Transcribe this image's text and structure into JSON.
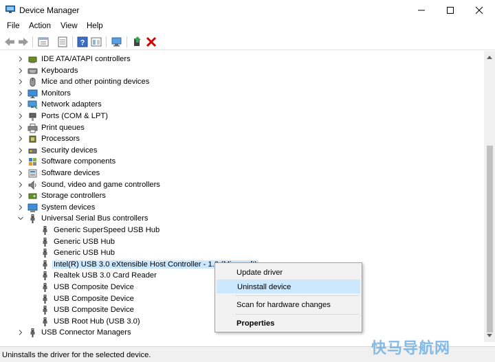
{
  "window": {
    "title": "Device Manager",
    "controls": {
      "minimize": "minimize-icon",
      "maximize": "maximize-icon",
      "close": "close-icon"
    }
  },
  "menu": [
    "File",
    "Action",
    "View",
    "Help"
  ],
  "toolbar": [
    "back-arrow-icon",
    "forward-arrow-icon",
    "properties-pane-icon",
    "device-list-icon",
    "help-icon",
    "view-icon",
    "scan-hardware-icon",
    "update-driver-icon",
    "uninstall-icon"
  ],
  "tree": [
    {
      "label": "IDE ATA/ATAPI controllers",
      "icon": "ide-controller-icon",
      "level": 0,
      "expanded": false
    },
    {
      "label": "Keyboards",
      "icon": "keyboard-icon",
      "level": 0,
      "expanded": false
    },
    {
      "label": "Mice and other pointing devices",
      "icon": "mouse-icon",
      "level": 0,
      "expanded": false
    },
    {
      "label": "Monitors",
      "icon": "monitor-icon",
      "level": 0,
      "expanded": false
    },
    {
      "label": "Network adapters",
      "icon": "network-adapter-icon",
      "level": 0,
      "expanded": false
    },
    {
      "label": "Ports (COM & LPT)",
      "icon": "port-icon",
      "level": 0,
      "expanded": false
    },
    {
      "label": "Print queues",
      "icon": "printer-icon",
      "level": 0,
      "expanded": false
    },
    {
      "label": "Processors",
      "icon": "processor-icon",
      "level": 0,
      "expanded": false
    },
    {
      "label": "Security devices",
      "icon": "security-device-icon",
      "level": 0,
      "expanded": false
    },
    {
      "label": "Software components",
      "icon": "software-component-icon",
      "level": 0,
      "expanded": false
    },
    {
      "label": "Software devices",
      "icon": "software-device-icon",
      "level": 0,
      "expanded": false
    },
    {
      "label": "Sound, video and game controllers",
      "icon": "speaker-icon",
      "level": 0,
      "expanded": false
    },
    {
      "label": "Storage controllers",
      "icon": "storage-controller-icon",
      "level": 0,
      "expanded": false
    },
    {
      "label": "System devices",
      "icon": "system-device-icon",
      "level": 0,
      "expanded": false
    },
    {
      "label": "Universal Serial Bus controllers",
      "icon": "usb-icon",
      "level": 0,
      "expanded": true
    },
    {
      "label": "Generic SuperSpeed USB Hub",
      "icon": "usb-icon",
      "level": 1
    },
    {
      "label": "Generic USB Hub",
      "icon": "usb-icon",
      "level": 1
    },
    {
      "label": "Generic USB Hub",
      "icon": "usb-icon",
      "level": 1
    },
    {
      "label": "Intel(R) USB 3.0 eXtensible Host Controller - 1.0 (Microsoft)",
      "icon": "usb-icon",
      "level": 1,
      "selected": true
    },
    {
      "label": "Realtek USB 3.0 Card Reader",
      "icon": "usb-icon",
      "level": 1
    },
    {
      "label": "USB Composite Device",
      "icon": "usb-icon",
      "level": 1
    },
    {
      "label": "USB Composite Device",
      "icon": "usb-icon",
      "level": 1
    },
    {
      "label": "USB Composite Device",
      "icon": "usb-icon",
      "level": 1
    },
    {
      "label": "USB Root Hub (USB 3.0)",
      "icon": "usb-icon",
      "level": 1
    },
    {
      "label": "USB Connector Managers",
      "icon": "usb-icon",
      "level": 0,
      "expanded": false
    }
  ],
  "context_menu": [
    {
      "label": "Update driver",
      "name": "update-driver"
    },
    {
      "label": "Uninstall device",
      "name": "uninstall-device",
      "highlighted": true
    },
    {
      "label": "Scan for hardware changes",
      "name": "scan-for-hardware-changes"
    },
    {
      "label": "Properties",
      "name": "properties",
      "bold": true
    }
  ],
  "status": "Uninstalls the driver for the selected device.",
  "watermark": "快马导航网",
  "colors": {
    "selection": "#cce8ff",
    "menu_bg": "#f2f2f2",
    "uninstall_red": "#d40000"
  }
}
